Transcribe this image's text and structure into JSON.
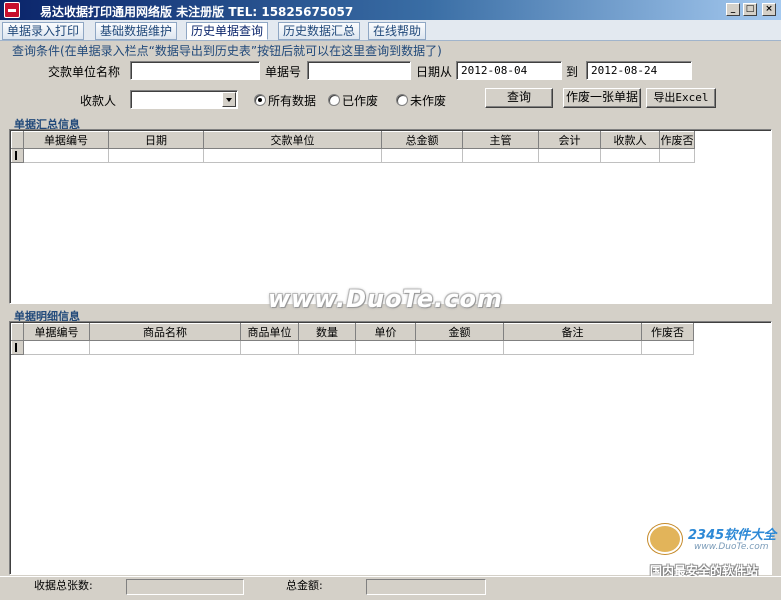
{
  "window": {
    "title": "易达收据打印通用网络版  未注册版    TEL: 15825675057",
    "controls": {
      "minimize": "_",
      "maximize": "□",
      "close": "×"
    }
  },
  "tabs": [
    {
      "label": "单据录入打印"
    },
    {
      "label": "基础数据维护"
    },
    {
      "label": "历史单据查询",
      "active": true
    },
    {
      "label": "历史数据汇总"
    },
    {
      "label": "在线帮助"
    }
  ],
  "query": {
    "hint": "查询条件(在单据录入栏点“数据导出到历史表”按钮后就可以在这里查询到数据了)",
    "payer_label": "交款单位名称",
    "payer_value": "",
    "doc_no_label": "单据号",
    "doc_no_value": "",
    "date_from_label": "日期从",
    "date_from_value": "2012-08-04",
    "date_to_label": "到",
    "date_to_value": "2012-08-24",
    "receiver_label": "收款人",
    "receiver_value": "",
    "radio_all": "所有数据",
    "radio_void": "已作废",
    "radio_notvoid": "未作废",
    "search_button": "查询",
    "void_button": "作废一张单据",
    "export_button": "导出Excel"
  },
  "summary": {
    "section_title": "单据汇总信息",
    "columns": [
      "单据编号",
      "日期",
      "交款单位",
      "总金额",
      "主管",
      "会计",
      "收款人",
      "作废否"
    ]
  },
  "detail": {
    "section_title": "单据明细信息",
    "columns": [
      "单据编号",
      "商品名称",
      "商品单位",
      "数量",
      "单价",
      "金额",
      "备注",
      "作废否"
    ]
  },
  "status": {
    "count_label": "收据总张数:",
    "total_label": "总金额:"
  },
  "watermark": "www.DuoTe.com",
  "corner_logo": {
    "brand": "2345软件大全",
    "url": "www.DuoTe.com",
    "tagline": "国内最安全的软件站"
  },
  "colors": {
    "accent": "#21497a",
    "titlebar": "#0a246a",
    "face": "#d4d0c8"
  }
}
